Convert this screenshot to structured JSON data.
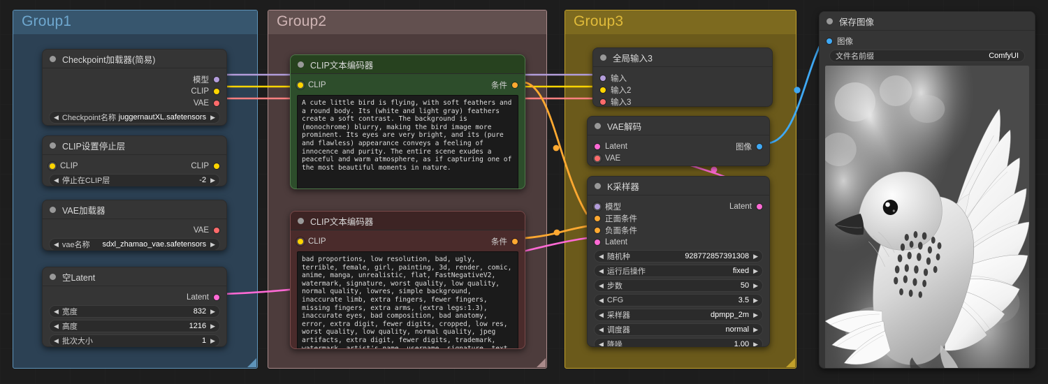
{
  "app": "ComfyUI node graph",
  "groups": [
    {
      "title": "Group1",
      "color": "#4a7fa5",
      "body": "#2c4154"
    },
    {
      "title": "Group2",
      "color": "#a98a8a",
      "body": "#55403f"
    },
    {
      "title": "Group3",
      "color": "#c2a02a",
      "body": "#6b5a1b"
    }
  ],
  "nodes": {
    "checkpoint_loader": {
      "title": "Checkpoint加载器(简易)",
      "outputs": [
        {
          "label": "模型",
          "color": "#b39ddb"
        },
        {
          "label": "CLIP",
          "color": "#ffd500"
        },
        {
          "label": "VAE",
          "color": "#ff6b6b"
        }
      ],
      "widgets": [
        {
          "name": "Checkpoint名称",
          "value": "juggernautXL.safetensors"
        }
      ]
    },
    "clip_set_last_layer": {
      "title": "CLIP设置停止层",
      "inputs": [
        {
          "label": "CLIP",
          "color": "#ffd500"
        }
      ],
      "outputs": [
        {
          "label": "CLIP",
          "color": "#ffd500"
        }
      ],
      "widgets": [
        {
          "name": "停止在CLIP层",
          "value": "-2"
        }
      ]
    },
    "vae_loader": {
      "title": "VAE加载器",
      "outputs": [
        {
          "label": "VAE",
          "color": "#ff6b6b"
        }
      ],
      "widgets": [
        {
          "name": "vae名称",
          "value": "sdxl_zhamao_vae.safetensors"
        }
      ]
    },
    "empty_latent": {
      "title": "空Latent",
      "outputs": [
        {
          "label": "Latent",
          "color": "#ff6ad5"
        }
      ],
      "widgets": [
        {
          "name": "宽度",
          "value": "832"
        },
        {
          "name": "高度",
          "value": "1216"
        },
        {
          "name": "批次大小",
          "value": "1"
        }
      ]
    },
    "clip_text_positive": {
      "title": "CLIP文本编码器",
      "accent": "#2d4d2b",
      "inputs": [
        {
          "label": "CLIP",
          "color": "#ffd500"
        }
      ],
      "outputs": [
        {
          "label": "条件",
          "color": "#ffa931"
        }
      ],
      "text": "A cute little bird is flying, with soft feathers and a round body. Its (white and light gray) feathers create a soft contrast. The background is (monochrome) blurry, making the bird image more prominent. Its eyes are very bright, and its (pure and flawless) appearance conveys a feeling of innocence and purity. The entire scene exudes a peaceful and warm atmosphere, as if capturing one of the most beautiful moments in nature."
    },
    "clip_text_negative": {
      "title": "CLIP文本编码器",
      "accent": "#4a2b2b",
      "inputs": [
        {
          "label": "CLIP",
          "color": "#ffd500"
        }
      ],
      "outputs": [
        {
          "label": "条件",
          "color": "#ffa931"
        }
      ],
      "text": "bad proportions, low resolution, bad, ugly, terrible, female, girl, painting, 3d, render, comic, anime, manga, unrealistic, flat, FastNegativeV2, watermark, signature, worst quality, low quality, normal quality, lowres, simple background, inaccurate limb, extra fingers, fewer fingers, missing fingers, extra arms, (extra legs:1.3), inaccurate eyes, bad composition, bad anatomy, error, extra digit, fewer digits, cropped, low res, worst quality, low quality, normal quality, jpeg artifacts, extra digit, fewer digits, trademark, watermark, artist's name, username, signature, text, words, human, american flag, muscular"
    },
    "global_input_3": {
      "title": "全局输入3",
      "inputs": [
        {
          "label": "输入",
          "color": "#b39ddb"
        },
        {
          "label": "输入2",
          "color": "#ffd500"
        },
        {
          "label": "输入3",
          "color": "#ff6b6b"
        }
      ]
    },
    "vae_decode": {
      "title": "VAE解码",
      "inputs": [
        {
          "label": "Latent",
          "color": "#ff6ad5"
        },
        {
          "label": "VAE",
          "color": "#ff6b6b"
        }
      ],
      "outputs": [
        {
          "label": "图像",
          "color": "#3fa9f5"
        }
      ]
    },
    "ksampler": {
      "title": "K采样器",
      "inputs": [
        {
          "label": "模型",
          "color": "#b39ddb"
        },
        {
          "label": "正面条件",
          "color": "#ffa931"
        },
        {
          "label": "负面条件",
          "color": "#ffa931"
        },
        {
          "label": "Latent",
          "color": "#ff6ad5"
        }
      ],
      "outputs": [
        {
          "label": "Latent",
          "color": "#ff6ad5"
        }
      ],
      "widgets": [
        {
          "name": "随机种",
          "value": "928772857391308"
        },
        {
          "name": "运行后操作",
          "value": "fixed"
        },
        {
          "name": "步数",
          "value": "50"
        },
        {
          "name": "CFG",
          "value": "3.5"
        },
        {
          "name": "采样器",
          "value": "dpmpp_2m"
        },
        {
          "name": "调度器",
          "value": "normal"
        },
        {
          "name": "降噪",
          "value": "1.00"
        }
      ]
    },
    "save_image": {
      "title": "保存图像",
      "inputs": [
        {
          "label": "图像",
          "color": "#3fa9f5"
        }
      ],
      "widgets": [
        {
          "name": "文件名前缀",
          "value": "ComfyUI"
        }
      ],
      "preview_alt": "monochrome photo of a small bird in flight with spread wings"
    }
  }
}
